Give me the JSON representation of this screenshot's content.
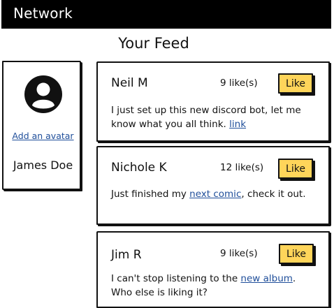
{
  "app": {
    "brand": "Network"
  },
  "feed": {
    "title": "Your Feed"
  },
  "profile": {
    "avatar_icon": "user-avatar-icon",
    "add_avatar_link": "Add an avatar",
    "name": "James Doe"
  },
  "posts": [
    {
      "author": "Neil M",
      "likes": "9 like(s)",
      "like_label": "Like",
      "text_before": "I just set up this new discord bot, let me know what you all think. ",
      "link": "link",
      "text_after": ""
    },
    {
      "author": "Nichole K",
      "likes": "12 like(s)",
      "like_label": "Like",
      "text_before": "Just finished my ",
      "link": "next comic",
      "text_after": ", check it out."
    },
    {
      "author": "Jim R",
      "likes": "9 like(s)",
      "like_label": "Like",
      "text_before": "I can't stop listening to the ",
      "link": "new album",
      "text_after": ". Who else is liking it?"
    }
  ],
  "colors": {
    "topbar": "#000000",
    "like_button": "#ffd55a",
    "link": "#1f4e9a"
  }
}
